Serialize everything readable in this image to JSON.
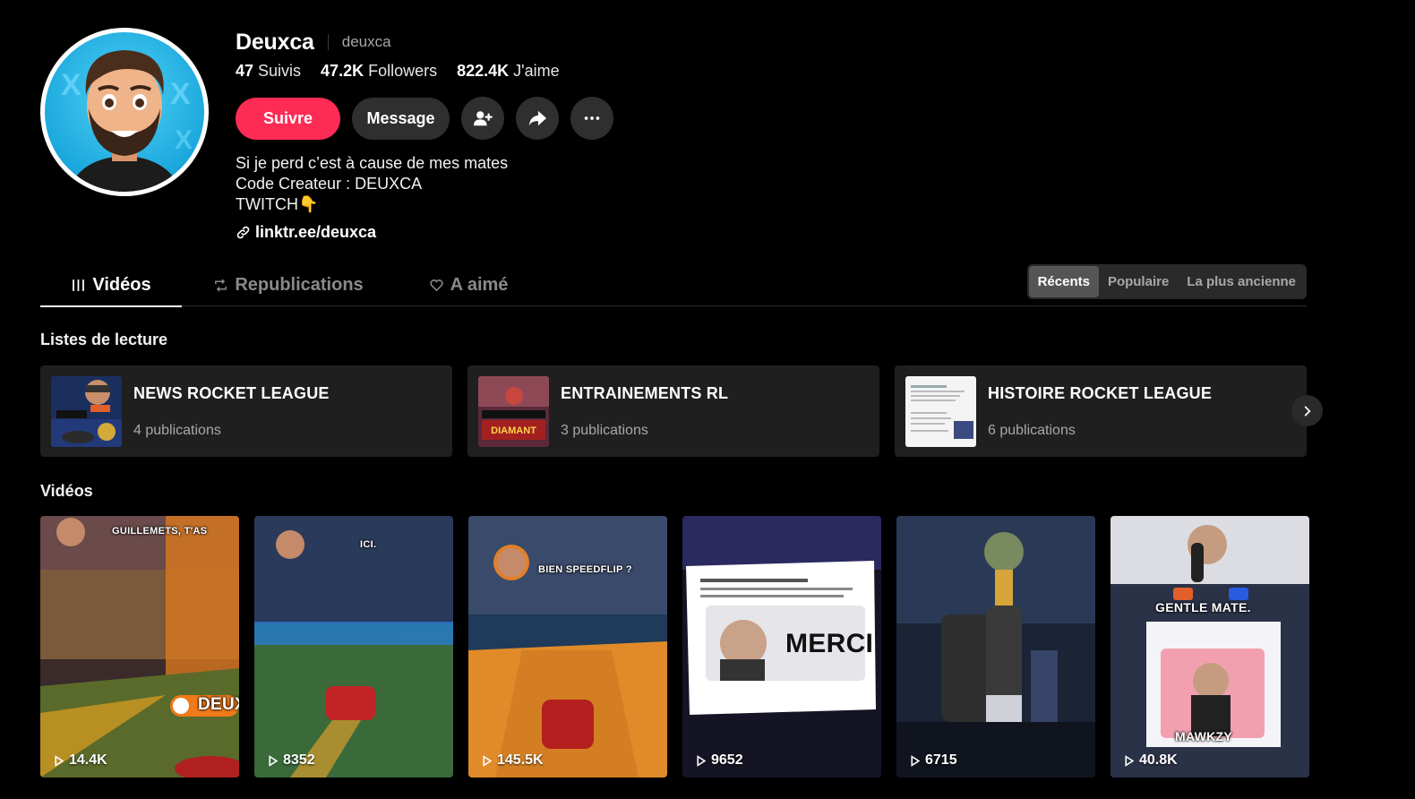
{
  "profile": {
    "display_name": "Deuxca",
    "username": "deuxca",
    "following_count": "47",
    "following_label": "Suivis",
    "followers_count": "47.2K",
    "followers_label": "Followers",
    "likes_count": "822.4K",
    "likes_label": "J'aime",
    "bio": [
      "Si je perd c’est à cause de mes mates",
      "Code Createur : DEUXCA",
      "TWITCH👇"
    ],
    "link": "linktr.ee/deuxca"
  },
  "actions": {
    "follow_label": "Suivre",
    "message_label": "Message"
  },
  "tabs": [
    {
      "label": "Vidéos",
      "active": true
    },
    {
      "label": "Republications",
      "active": false
    },
    {
      "label": "A aimé",
      "active": false
    }
  ],
  "sort": [
    {
      "label": "Récents",
      "active": true
    },
    {
      "label": "Populaire",
      "active": false
    },
    {
      "label": "La plus ancienne",
      "active": false
    }
  ],
  "playlists_title": "Listes de lecture",
  "playlists": [
    {
      "title": "NEWS ROCKET LEAGUE",
      "count": "4 publications"
    },
    {
      "title": "ENTRAINEMENTS RL",
      "count": "3 publications",
      "thumb_text": "DIAMANT"
    },
    {
      "title": "HISTOIRE ROCKET LEAGUE",
      "count": "6 publications"
    }
  ],
  "videos_title": "Vidéos",
  "videos": [
    {
      "views": "14.4K",
      "caption": "GUILLEMETS, T'AS",
      "extra": "DEUX"
    },
    {
      "views": "8352",
      "caption": "ICI."
    },
    {
      "views": "145.5K",
      "caption": "BIEN SPEEDFLIP ?"
    },
    {
      "views": "9652",
      "caption": "MERCI"
    },
    {
      "views": "6715"
    },
    {
      "views": "40.8K",
      "caption": "GENTLE MATE.",
      "extra": "MAWKZY"
    }
  ],
  "colors": {
    "accent": "#fe2c55",
    "background": "#000000",
    "surface": "#1f1f1f",
    "button": "#2f2f2f"
  }
}
